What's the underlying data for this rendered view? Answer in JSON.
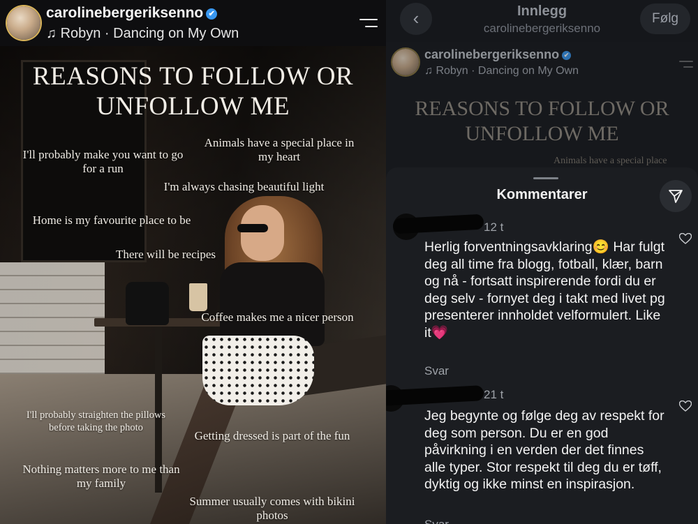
{
  "post": {
    "username": "carolinebergeriksenno",
    "verified_mark": "✔",
    "music_note": "♫",
    "music_text": "Robyn · Dancing on My Own",
    "title_line1": "REASONS TO FOLLOW OR",
    "title_line2": "UNFOLLOW ME",
    "phrases": [
      "I'll probably make you want to go for a run",
      "Animals have a special place in my heart",
      "I'm always chasing beautiful light",
      "Home is my favourite place to be",
      "There will be recipes",
      "Coffee makes me a nicer person",
      "I'll probably straighten the pillows before taking the photo",
      "Getting dressed is part of the fun",
      "Nothing matters more to me than my family",
      "Summer usually comes with bikini photos"
    ]
  },
  "header": {
    "back_icon": "chevron-left-icon",
    "back_glyph": "‹",
    "title": "Innlegg",
    "subtitle": "carolinebergeriksenno",
    "follow_label": "Følg"
  },
  "preview": {
    "phrase": "Animals have a special place"
  },
  "comments_sheet": {
    "title": "Kommentarer",
    "share_icon": "send-icon",
    "comments": [
      {
        "time": "12 t",
        "text": "Herlig forventningsavklaring😊 Har fulgt deg all time fra blogg, fotball, klær, barn og nå - fortsatt inspirerende fordi du er deg selv - fornyet deg i takt med livet pg presenterer innholdet velformulert. Like it💗",
        "reply_label": "Svar"
      },
      {
        "time": "21 t",
        "text": "Jeg begynte og følge deg av respekt for deg som person. Du er en god påvirkning i en verden der det finnes alle  typer. Stor respekt til deg du er tøff, dyktig og ikke minst en inspirasjon.",
        "reply_label": "Svar"
      }
    ]
  },
  "colors": {
    "verified": "#3897f0",
    "sheet_bg": "#1b1d21",
    "story_ring": "#d9b45a"
  }
}
